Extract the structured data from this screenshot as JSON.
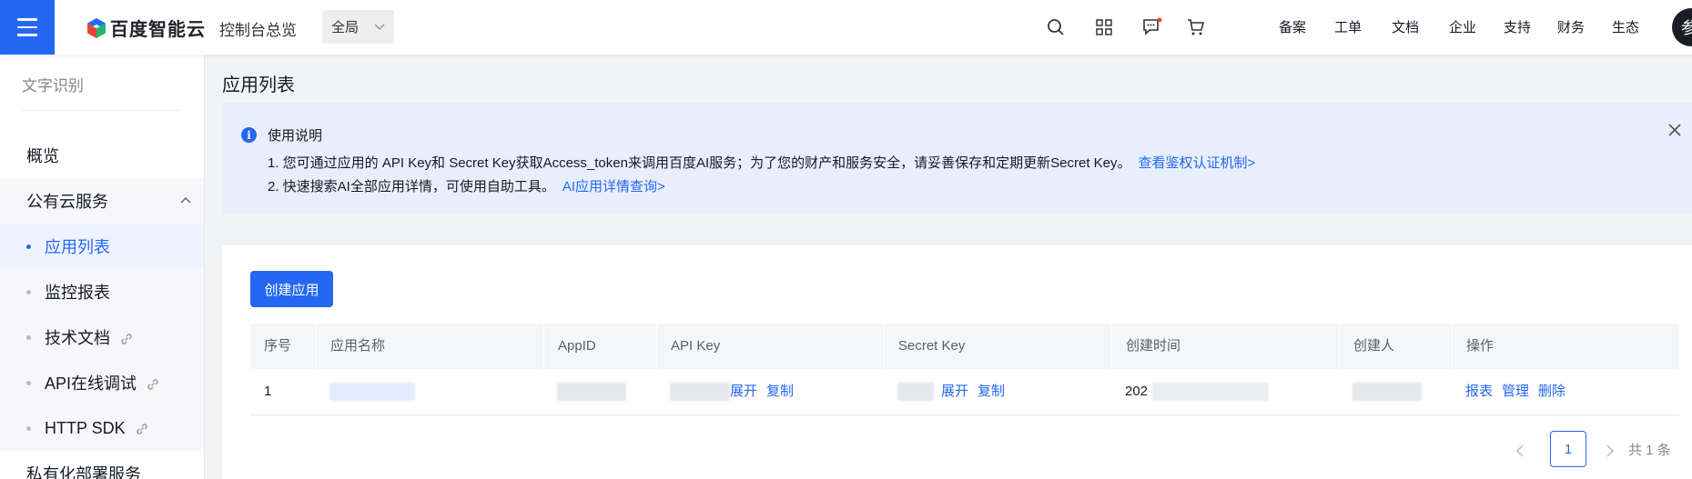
{
  "topbar": {
    "logo_text": "百度智能云",
    "console_link": "控制台总览",
    "region": "全局",
    "nav": [
      "备案",
      "工单",
      "文档",
      "企业",
      "支持",
      "财务",
      "生态"
    ],
    "avatar_text": "参"
  },
  "sidebar": {
    "title": "文字识别",
    "overview": "概览",
    "public_group": "公有云服务",
    "items": [
      {
        "label": "应用列表"
      },
      {
        "label": "监控报表"
      },
      {
        "label": "技术文档"
      },
      {
        "label": "API在线调试"
      },
      {
        "label": "HTTP SDK"
      }
    ],
    "private_group": "私有化部署服务"
  },
  "main": {
    "page_title": "应用列表",
    "notice": {
      "title": "使用说明",
      "line1": "1. 您可通过应用的 API Key和 Secret Key获取Access_token来调用百度AI服务；为了您的财产和服务安全，请妥善保存和定期更新Secret Key。",
      "line1_link": "查看鉴权认证机制>",
      "line2": "2. 快速搜索AI全部应用详情，可使用自助工具。",
      "line2_link": "AI应用详情查询>"
    },
    "create_button": "创建应用",
    "table": {
      "headers": [
        "序号",
        "应用名称",
        "AppID",
        "API Key",
        "Secret Key",
        "创建时间",
        "创建人",
        "操作"
      ],
      "rows": [
        {
          "index": "1",
          "apikey_expand": "展开",
          "apikey_copy": "复制",
          "secret_expand": "展开",
          "secret_copy": "复制",
          "created_prefix": "202",
          "actions": [
            "报表",
            "管理",
            "删除"
          ]
        }
      ]
    },
    "pagination": {
      "current": "1",
      "total": "共 1 条"
    }
  },
  "colors": {
    "primary": "#2468f2",
    "notice_bg": "#e8eefb",
    "page_bg": "#f2f3f5"
  }
}
